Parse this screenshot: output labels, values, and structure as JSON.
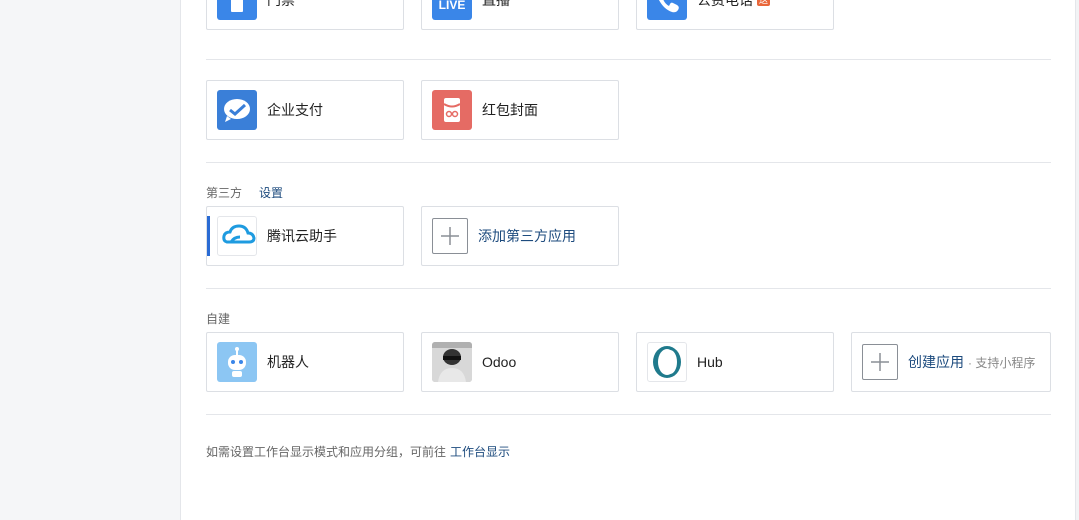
{
  "colors": {
    "link": "#1d4b7e",
    "accent_blue": "#3a86e8",
    "red": "#e56b64",
    "badge": "#e9673a"
  },
  "row1": [
    {
      "label": "门禁",
      "icon": "door-access-icon"
    },
    {
      "label": "直播",
      "icon": "live-icon",
      "icon_text": "LIVE"
    },
    {
      "label": "公费电话",
      "icon": "phone-icon",
      "badge": "送"
    }
  ],
  "row2": [
    {
      "label": "企业支付",
      "icon": "wecom-pay-icon"
    },
    {
      "label": "红包封面",
      "icon": "red-packet-icon"
    }
  ],
  "third_party": {
    "title": "第三方",
    "settings_link": "设置",
    "apps": [
      {
        "label": "腾讯云助手",
        "icon": "tencent-cloud-icon"
      },
      {
        "label": "添加第三方应用",
        "icon": "plus-icon"
      }
    ]
  },
  "self_built": {
    "title": "自建",
    "apps": [
      {
        "label": "机器人",
        "icon": "robot-icon"
      },
      {
        "label": "Odoo",
        "icon": "odoo-avatar-icon"
      },
      {
        "label": "Hub",
        "icon": "hub-icon"
      },
      {
        "label": "创建应用",
        "sub": "· 支持小程序",
        "icon": "plus-icon"
      }
    ]
  },
  "footer": {
    "text": "如需设置工作台显示模式和应用分组，可前往",
    "link": "工作台显示"
  }
}
